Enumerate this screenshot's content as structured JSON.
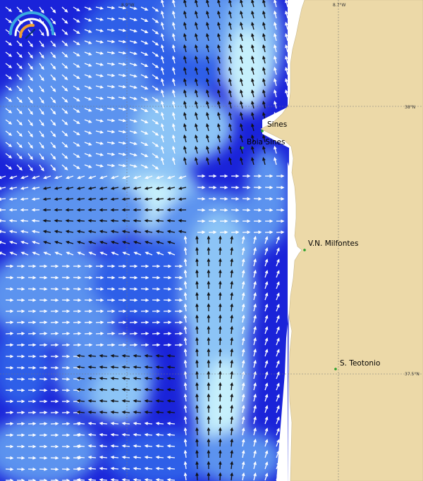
{
  "grid_labels": {
    "lon_left": "8.9°W",
    "lon_right": "8.7°W",
    "lat_top": "38°N",
    "lat_bottom": "37.5°N"
  },
  "places": [
    {
      "name": "Sines"
    },
    {
      "name": "Boia Sines"
    },
    {
      "name": "V.N. Milfontes"
    },
    {
      "name": "S. Teotonio"
    }
  ],
  "colors": {
    "land": "#ecd9a8",
    "coast_gap": "#ffffff",
    "sea_deep": "#1a23d9",
    "sea_mid": "#2f5fe8",
    "sea_light": "#5b93ef",
    "sea_pale": "#8cc4f6",
    "sea_palest": "#c6f0fc",
    "arrow_light": "#ffffff",
    "arrow_dark": "#111111",
    "marker": "#2aa02a",
    "logo_ring": "#39a9e0",
    "logo_accent": "#f0a030"
  },
  "logo": {
    "icon": "current-speed-gauge-icon"
  }
}
